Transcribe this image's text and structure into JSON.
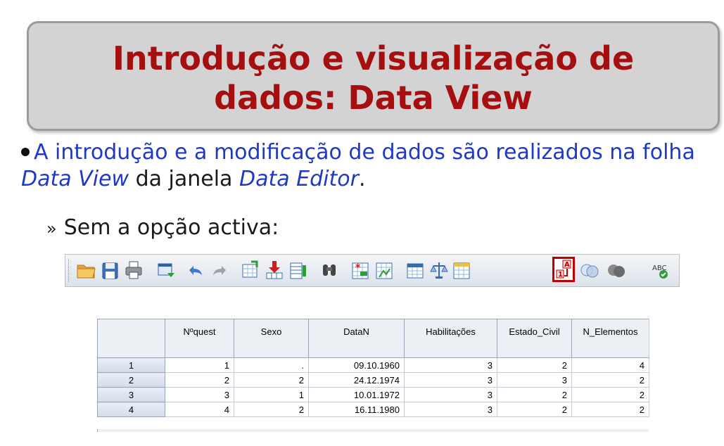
{
  "slide": {
    "title_line1": "Introdução e visualização de",
    "title_line2": "dados: Data View",
    "bullet_part1": "A introdução e a modificação de dados são realizados na folha",
    "bullet_italic1": "Data View",
    "bullet_mid": " da janela ",
    "bullet_italic2": "Data Editor",
    "bullet_end": ".",
    "sub_mark": "»",
    "sub_text": "Sem a opção activa:"
  },
  "toolbar": {
    "icons": [
      "open-folder-icon",
      "save-icon",
      "print-icon",
      "dialog-recall-icon",
      "undo-icon",
      "redo-icon",
      "goto-case-icon",
      "goto-variable-icon",
      "variables-icon",
      "find-icon",
      "insert-cases-icon",
      "insert-variable-icon",
      "split-file-icon",
      "weight-cases-icon",
      "select-cases-icon",
      "value-labels-icon",
      "use-variable-sets-icon",
      "show-all-variables-icon",
      "spell-check-icon"
    ],
    "active_icon": "value-labels-icon",
    "active_color": "#c00000",
    "spell_label": "ABC"
  },
  "grid": {
    "columns": [
      "",
      "Nºquest",
      "Sexo",
      "DataN",
      "Habilitações",
      "Estado_Civil",
      "N_Elementos"
    ],
    "rows": [
      [
        "1",
        "1",
        ".",
        "09.10.1960",
        "3",
        "2",
        "4"
      ],
      [
        "2",
        "2",
        "2",
        "24.12.1974",
        "3",
        "3",
        "2"
      ],
      [
        "3",
        "3",
        "1",
        "10.01.1972",
        "3",
        "2",
        "2"
      ],
      [
        "4",
        "4",
        "2",
        "16.11.1980",
        "3",
        "2",
        "2"
      ]
    ]
  }
}
